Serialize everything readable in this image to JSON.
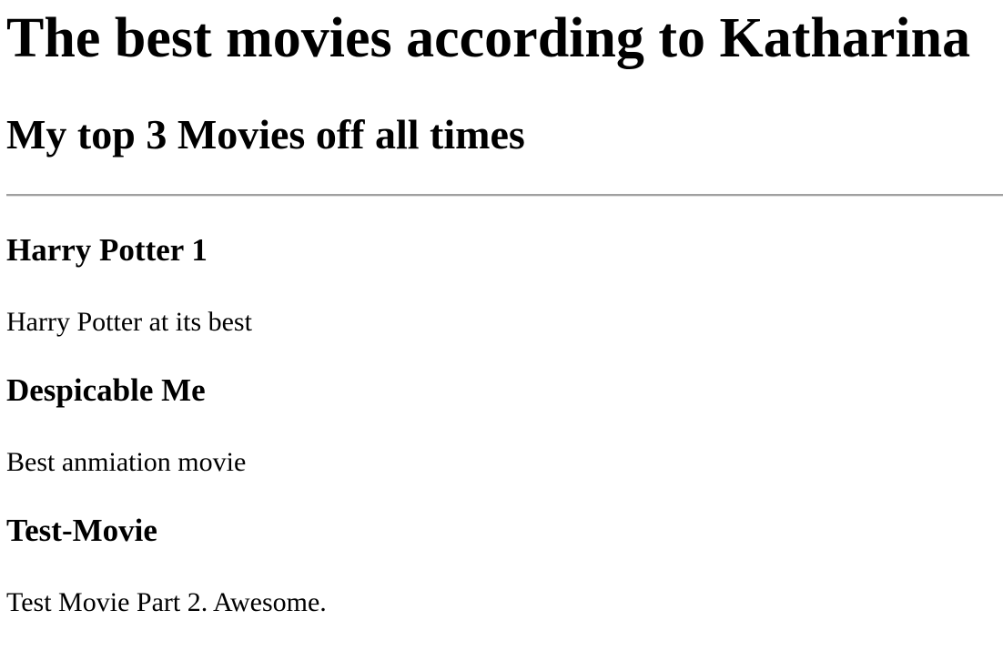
{
  "header": {
    "title": "The best movies according to Katharina",
    "subtitle": "My top 3 Movies off all times"
  },
  "movies": [
    {
      "title": "Harry Potter 1",
      "description": "Harry Potter at its best"
    },
    {
      "title": "Despicable Me",
      "description": "Best anmiation movie"
    },
    {
      "title": "Test-Movie",
      "description": "Test Movie Part 2. Awesome."
    }
  ],
  "colors": {
    "background": "#ffffff",
    "text": "#000000",
    "divider": "#a0a0a0"
  }
}
